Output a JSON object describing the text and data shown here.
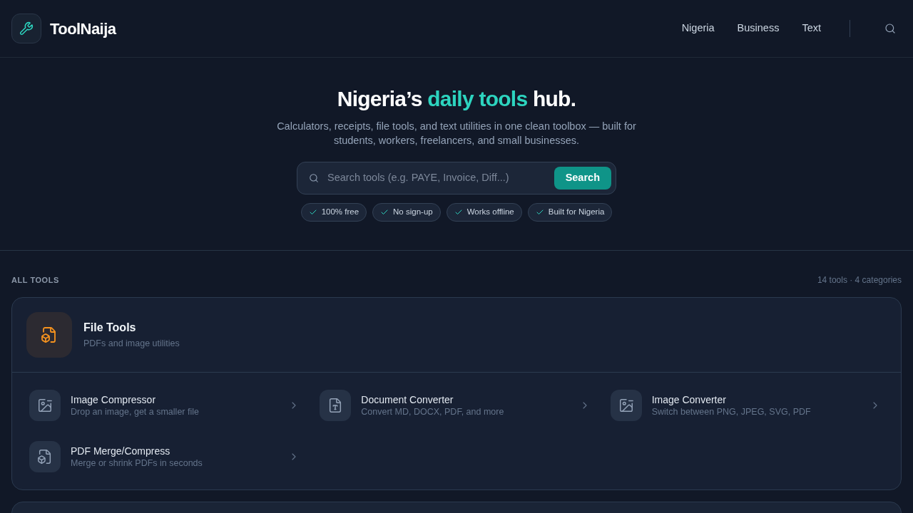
{
  "header": {
    "logo": "ToolNaija",
    "nav": [
      {
        "label": "Nigeria"
      },
      {
        "label": "Business"
      },
      {
        "label": "Text"
      }
    ]
  },
  "hero": {
    "title": {
      "before": "Nigeria’s",
      "highlight": "daily tools",
      "after": "hub."
    },
    "subtitle": "Calculators, receipts, file tools, and text utilities in one clean toolbox — built for students, workers, freelancers, and small businesses.",
    "search": {
      "placeholder": "Search tools (e.g. PAYE, Invoice, Diff...)",
      "button": "Search"
    },
    "features": [
      "100% free",
      "No sign-up",
      "Works offline",
      "Built for Nigeria"
    ]
  },
  "tools_section": {
    "heading": "ALL TOOLS",
    "summary": "14 tools · 4 categories",
    "categories": [
      {
        "kind": "file",
        "title": "File Tools",
        "subtitle": "PDFs and image utilities",
        "tools": [
          {
            "kind": "image",
            "name": "Image Compressor",
            "description": "Drop an image, get a smaller file"
          },
          {
            "kind": "document",
            "name": "Document Converter",
            "description": "Convert MD, DOCX, PDF, and more"
          },
          {
            "kind": "image",
            "name": "Image Converter",
            "description": "Switch between PNG, JPEG, SVG, PDF"
          },
          {
            "kind": "pdf",
            "name": "PDF Merge/Compress",
            "description": "Merge or shrink PDFs in seconds"
          }
        ]
      }
    ]
  }
}
